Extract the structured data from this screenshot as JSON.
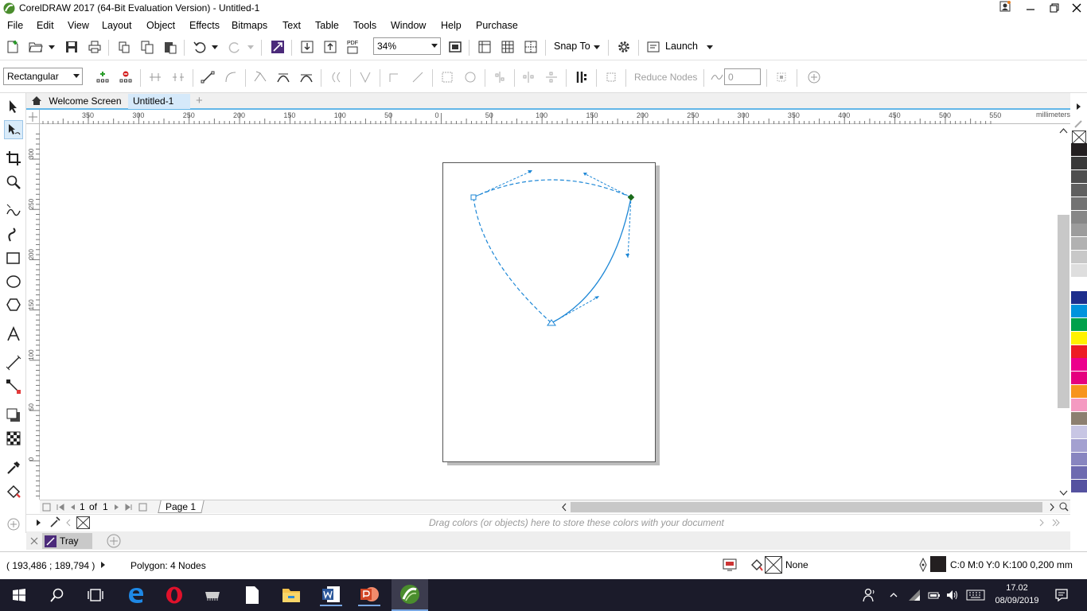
{
  "window": {
    "title": "CorelDRAW 2017 (64-Bit Evaluation Version) - Untitled-1",
    "controls": [
      "minimize",
      "restore",
      "close"
    ]
  },
  "menu": {
    "items": [
      "File",
      "Edit",
      "View",
      "Layout",
      "Object",
      "Effects",
      "Bitmaps",
      "Text",
      "Table",
      "Tools",
      "Window",
      "Help",
      "Purchase"
    ]
  },
  "standard_toolbar": {
    "zoom_value": "34%",
    "snap_to_label": "Snap To",
    "launch_label": "Launch",
    "pdf_label": "PDF"
  },
  "property_bar": {
    "selection_mode": "Rectangular",
    "reduce_nodes_label": "Reduce Nodes",
    "curve_smoothness_value": "0"
  },
  "tabs": [
    {
      "label": "Welcome Screen",
      "active": false
    },
    {
      "label": "Untitled-1",
      "active": true
    }
  ],
  "ruler": {
    "h_labels": [
      "350",
      "300",
      "250",
      "200",
      "150",
      "100",
      "50",
      "0",
      "50",
      "100",
      "150",
      "200",
      "250",
      "300",
      "350",
      "400",
      "450",
      "500",
      "550"
    ],
    "h_unit": "millimeters",
    "v_labels": [
      "300",
      "250",
      "200",
      "150",
      "100",
      "50",
      "0"
    ]
  },
  "page_nav": {
    "current": "1",
    "of_label": "of",
    "total": "1",
    "page_tab": "Page 1"
  },
  "document_palette": {
    "hint": "Drag colors (or objects) here to store these colors with your document"
  },
  "tray": {
    "label": "Tray"
  },
  "status": {
    "coordinates": "( 193,486 ; 189,794 )",
    "object_info": "Polygon: 4 Nodes",
    "fill_label": "None",
    "outline_info": "C:0 M:0 Y:0 K:100  0,200 mm"
  },
  "palette_colors": [
    "#231f20",
    "#3a3a3a",
    "#4e4e4e",
    "#606060",
    "#737373",
    "#878787",
    "#9c9c9c",
    "#b1b1b1",
    "#c8c8c8",
    "#dedede",
    "#ffffff",
    "#1d2e8c",
    "#0093dd",
    "#00a14b",
    "#fff200",
    "#ed1c24",
    "#ec008c",
    "#e5007e",
    "#f7941d",
    "#f49ac1",
    "#8c7f70",
    "#c8c6e4",
    "#a3a0d0",
    "#8885c0",
    "#6d6ab0",
    "#5552a0"
  ],
  "taskbar": {
    "time": "17.02",
    "date": "08/09/2019"
  },
  "colors": {
    "accent": "#63b6e8",
    "curve": "#1d87d6",
    "taskbar_bg": "#1b1b2a"
  }
}
